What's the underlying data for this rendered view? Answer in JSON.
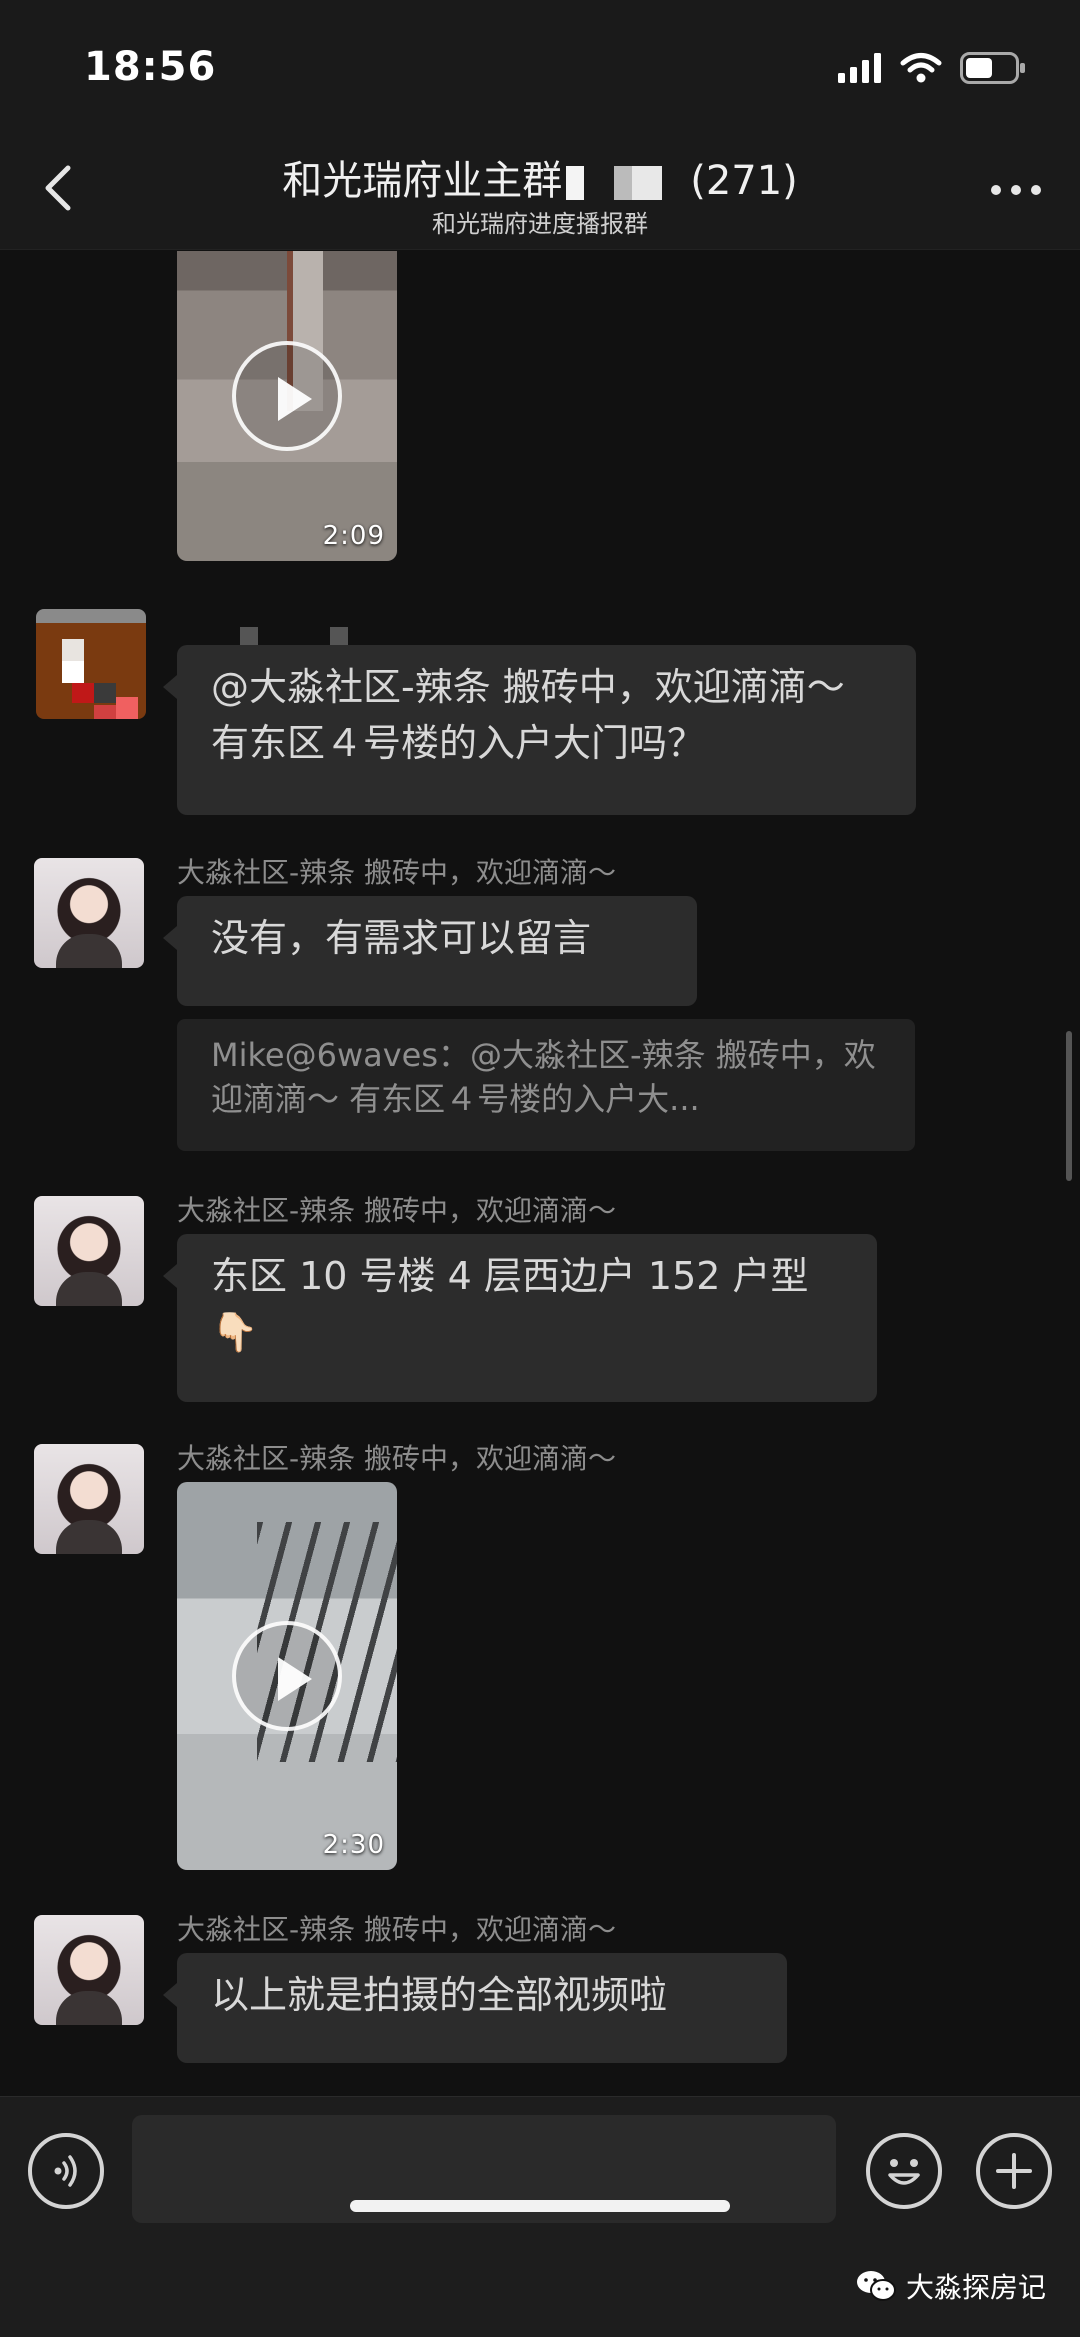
{
  "status_bar": {
    "time": "18:56"
  },
  "header": {
    "title_prefix": "和光瑞府业主群",
    "title_count": "(271)",
    "subtitle": "和光瑞府进度播报群"
  },
  "messages": [
    {
      "type": "video",
      "duration": "2:09"
    },
    {
      "type": "text",
      "sender": "",
      "text": "@大淼社区-辣条 搬砖中，欢迎滴滴～ 有东区４号楼的入户大门吗？"
    },
    {
      "type": "text",
      "sender": "大淼社区-辣条 搬砖中，欢迎滴滴～",
      "text": "没有，有需求可以留言",
      "quote": "Mike@6waves：@大淼社区-辣条 搬砖中，欢迎滴滴～ 有东区４号楼的入户大..."
    },
    {
      "type": "text",
      "sender": "大淼社区-辣条 搬砖中，欢迎滴滴～",
      "text": "东区 10 号楼 4 层西边户 152 户型",
      "emoji": "👇🏻"
    },
    {
      "type": "video",
      "sender": "大淼社区-辣条 搬砖中，欢迎滴滴～",
      "duration": "2:30"
    },
    {
      "type": "text",
      "sender": "大淼社区-辣条 搬砖中，欢迎滴滴～",
      "text": "以上就是拍摄的全部视频啦"
    }
  ],
  "input_bar": {
    "placeholder": ""
  },
  "watermark": {
    "text": "大淼探房记"
  }
}
